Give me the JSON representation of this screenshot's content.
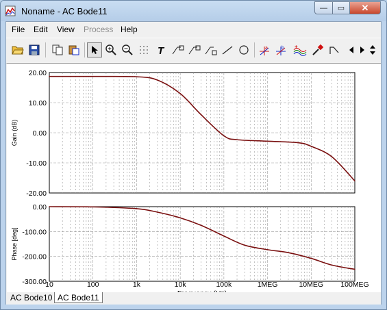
{
  "window": {
    "title": "Noname - AC Bode11",
    "minimize_label": "—",
    "maximize_label": "▭",
    "close_label": "✕"
  },
  "menu": [
    {
      "label": "File",
      "enabled": true
    },
    {
      "label": "Edit",
      "enabled": true
    },
    {
      "label": "View",
      "enabled": true
    },
    {
      "label": "Process",
      "enabled": false
    },
    {
      "label": "Help",
      "enabled": true
    }
  ],
  "toolbar": {
    "icons": [
      "open-folder-icon",
      "save-icon",
      "copy-icon",
      "paste-icon",
      "pointer-icon",
      "zoom-in-icon",
      "zoom-out-icon",
      "grid-icon",
      "text-icon",
      "tag-icon",
      "tag-icon",
      "tag-icon",
      "line-icon",
      "circle-icon",
      "cursor-a-icon",
      "cursor-b-icon",
      "waves-icon",
      "probe-icon",
      "step-icon",
      "scroll-left-icon",
      "scroll-right-icon"
    ]
  },
  "colors": {
    "trace": "#7a1010",
    "grid": "#9a9a9a",
    "accent_red": "#d01010",
    "accent_blue": "#1028c8"
  },
  "chart_data": [
    {
      "type": "line",
      "xscale": "log",
      "xlim": [
        10,
        100000000
      ],
      "ylim": [
        -20,
        20
      ],
      "ylabel": "Gain (dB)",
      "yticks": [
        "20.00",
        "10.00",
        "0.00",
        "-10.00",
        "-20.00"
      ],
      "grid": true,
      "series": [
        {
          "x": [
            10,
            100,
            1000,
            3000,
            10000,
            30000,
            100000,
            200000,
            1000000,
            5000000,
            10000000,
            30000000,
            100000000
          ],
          "values": [
            18.7,
            18.7,
            18.6,
            17.5,
            13.0,
            6.0,
            -1.0,
            -2.3,
            -2.8,
            -3.3,
            -4.5,
            -8.0,
            -16.0
          ]
        }
      ]
    },
    {
      "type": "line",
      "xscale": "log",
      "xlim": [
        10,
        100000000
      ],
      "ylim": [
        -300,
        0
      ],
      "ylabel": "Phase [deg]",
      "xlabel": "Frequency (Hz)",
      "yticks": [
        "0.00",
        "-100.00",
        "-200.00",
        "-300.00"
      ],
      "xticks": [
        "10",
        "100",
        "1k",
        "10k",
        "100k",
        "1MEG",
        "10MEG",
        "100MEG"
      ],
      "grid": true,
      "series": [
        {
          "x": [
            10,
            100,
            1000,
            3000,
            10000,
            30000,
            100000,
            300000,
            1000000,
            3000000,
            10000000,
            30000000,
            100000000
          ],
          "values": [
            0,
            -1,
            -8,
            -22,
            -45,
            -75,
            -118,
            -155,
            -173,
            -185,
            -208,
            -235,
            -252
          ]
        }
      ]
    }
  ],
  "tabs": [
    {
      "label": "AC Bode10",
      "active": false
    },
    {
      "label": "AC Bode11",
      "active": true
    }
  ]
}
